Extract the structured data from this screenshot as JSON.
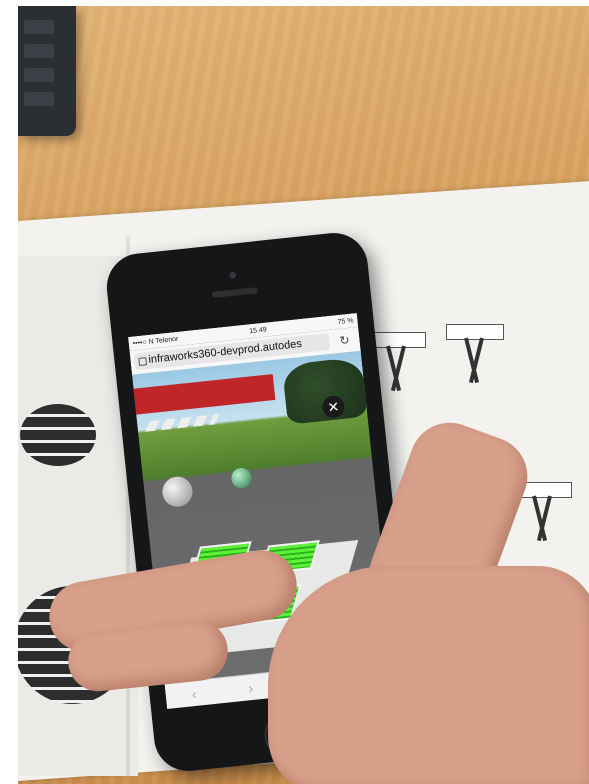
{
  "phone": {
    "status": {
      "carrier": "••••○ N Telenor",
      "time": "15.49",
      "battery": "75 %"
    },
    "url": "infraworks360-devprod.autodes"
  },
  "icons": [
    "lock-icon",
    "reload-icon",
    "close-icon",
    "back-icon",
    "forward-icon",
    "share-icon"
  ],
  "colors": {
    "desk": "#d39a55",
    "phone_body": "#151617",
    "green_pad": "#5cf23a",
    "red_building": "#c0252a"
  }
}
